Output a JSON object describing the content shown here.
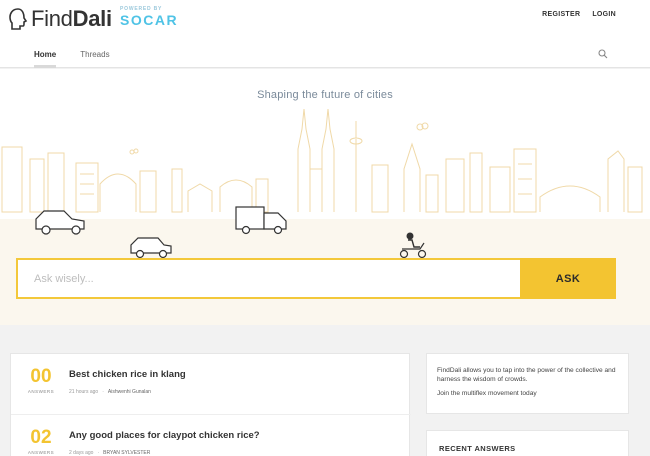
{
  "header": {
    "brand_light": "Find",
    "brand_bold": "Dali",
    "powered_label": "POWERED BY",
    "powered_brand": "SOCAR",
    "links": [
      "REGISTER",
      "LOGIN"
    ]
  },
  "nav": {
    "tabs": [
      {
        "label": "Home",
        "active": true
      },
      {
        "label": "Threads",
        "active": false
      }
    ]
  },
  "hero": {
    "tagline": "Shaping the future of cities",
    "ask_placeholder": "Ask wisely...",
    "ask_button": "ASK"
  },
  "threads": [
    {
      "count": "00",
      "count_label": "ANSWERS",
      "title": "Best chicken rice in klang",
      "time": "21 hours ago",
      "author": "Aishwenhi Gunalan"
    },
    {
      "count": "02",
      "count_label": "ANSWERS",
      "title": "Any good places for claypot chicken rice?",
      "time": "2 days ago",
      "author": "BRYAN SYLVESTER"
    }
  ],
  "info": {
    "text": "FindDali allows you to tap into the power of the collective and harness the wisdom of crowds.",
    "link": "Join the multiflex movement today"
  },
  "recent": {
    "title": "RECENT ANSWERS"
  },
  "colors": {
    "accent": "#f3c431",
    "socar": "#4fc3e6",
    "skyline": "#f0d9a8"
  }
}
